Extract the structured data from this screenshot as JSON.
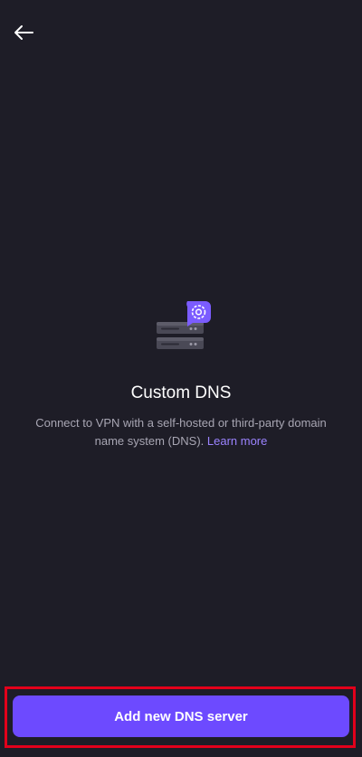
{
  "navigation": {
    "back_icon": "arrow-left-icon"
  },
  "empty_state": {
    "illustration_icon": "dns-server-gear-icon",
    "title": "Custom DNS",
    "description": "Connect to VPN with a self-hosted or third-party domain name system (DNS).",
    "learn_more_label": "Learn more"
  },
  "actions": {
    "add_button_label": "Add new DNS server"
  },
  "colors": {
    "background": "#1e1d27",
    "accent": "#6d4aff",
    "link": "#9b83ff",
    "highlight_border": "#e3001b"
  }
}
